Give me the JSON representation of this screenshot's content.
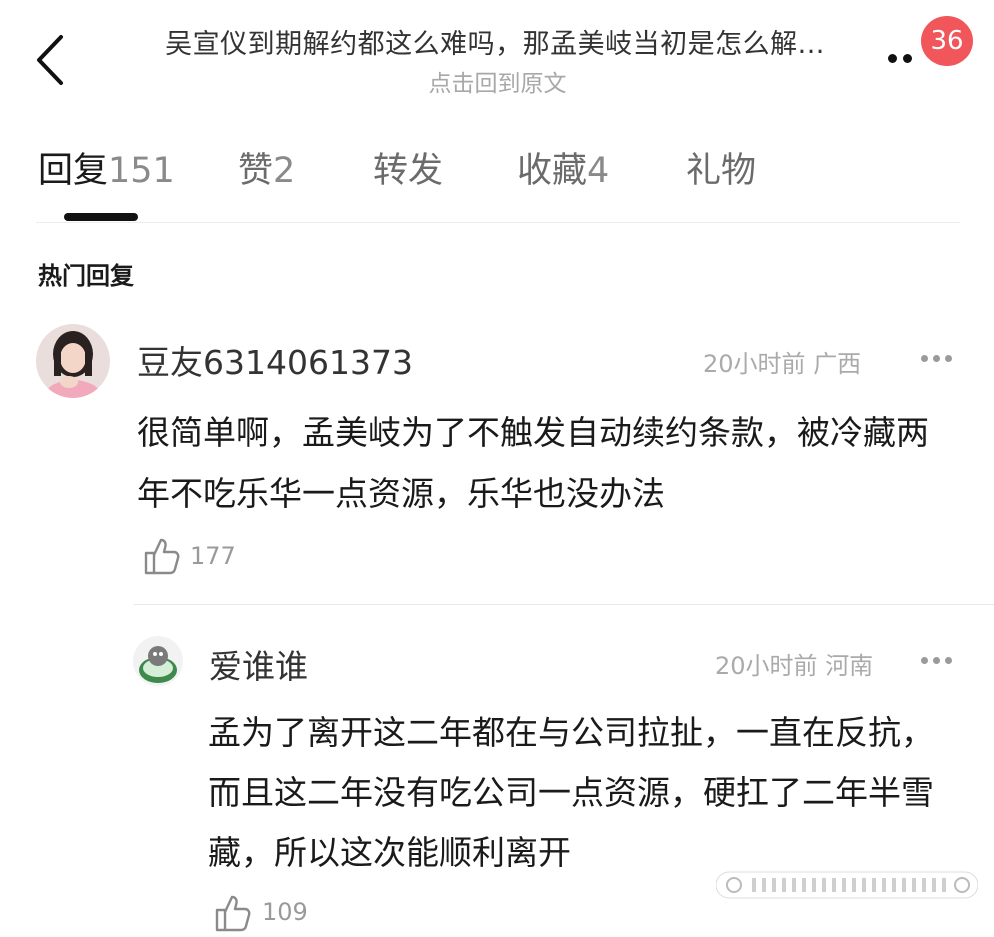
{
  "header": {
    "title": "吴宣仪到期解约都这么难吗，那孟美岐当初是怎么解...",
    "subtitle": "点击回到原文",
    "badge_count": "36",
    "back_icon": "chevron-left-icon",
    "more_icon": "more-dots-icon"
  },
  "tabs": [
    {
      "label": "回复",
      "count": "151",
      "active": true
    },
    {
      "label": "赞",
      "count": "2",
      "active": false
    },
    {
      "label": "转发",
      "count": "",
      "active": false
    },
    {
      "label": "收藏",
      "count": "4",
      "active": false
    },
    {
      "label": "礼物",
      "count": "",
      "active": false
    }
  ],
  "section": {
    "title": "热门回复"
  },
  "comments": [
    {
      "username": "豆友6314061373",
      "time": "20小时前",
      "location": "广西",
      "text": "很简单啊，孟美岐为了不触发自动续约条款，被冷藏两年不吃乐华一点资源，乐华也没办法",
      "likes": "177"
    },
    {
      "username": "爱谁谁",
      "time": "20小时前",
      "location": "河南",
      "text": "孟为了离开这二年都在与公司拉扯，一直在反抗，而且这二年没有吃公司一点资源，硬扛了二年半雪藏，所以这次能顺利离开",
      "likes": "109"
    }
  ],
  "colors": {
    "badge": "#f0565a",
    "text_primary": "#1a1a1a",
    "text_muted": "#aaaaaa"
  }
}
